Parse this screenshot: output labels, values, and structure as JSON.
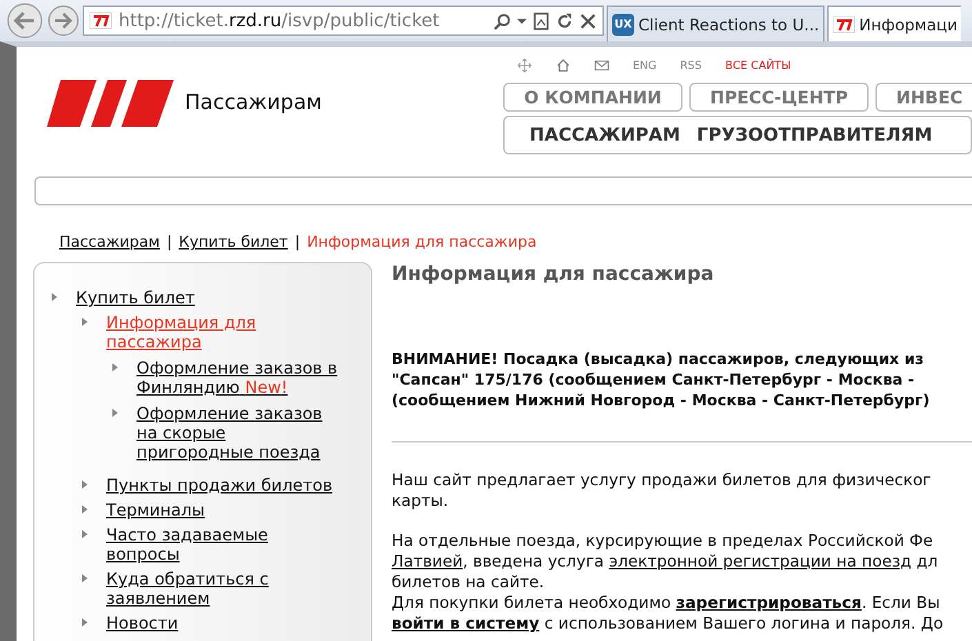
{
  "browser": {
    "address": {
      "prefix": "http://ticket.",
      "domain": "rzd.ru",
      "path": "/isvp/public/ticket"
    },
    "tabs": [
      {
        "favicon_text": "UX",
        "title": "Client Reactions to U...",
        "selected": false
      },
      {
        "title": "Информаци",
        "selected": true
      }
    ]
  },
  "utility_links": [
    {
      "kind": "icon"
    },
    {
      "kind": "icon"
    },
    {
      "kind": "icon"
    },
    {
      "kind": "text",
      "label": "ENG",
      "accent": false
    },
    {
      "kind": "text",
      "label": "RSS",
      "accent": false
    },
    {
      "kind": "text",
      "label": "ВСЕ САЙТЫ",
      "accent": true
    }
  ],
  "logo": {
    "caption": "Пассажирам"
  },
  "top_nav": [
    "О КОМПАНИИ",
    "ПРЕСС-ЦЕНТР",
    "ИНВЕС"
  ],
  "main_nav": [
    "ПАССАЖИРАМ",
    "ГРУЗООТПРАВИТЕЛЯМ"
  ],
  "breadcrumb": [
    {
      "label": "Пассажирам",
      "current": false
    },
    {
      "separator": "|",
      "label": "Купить билет",
      "current": false
    },
    {
      "separator": "|",
      "label": "Информация для пассажира",
      "current": true
    }
  ],
  "sidebar": [
    {
      "label": "Купить билет",
      "selected": false,
      "children": [
        {
          "label": "Информация для пассажира",
          "selected": true,
          "children": [
            {
              "label": "Оформление заказов в Финляндию",
              "badge": "New!",
              "selected": false
            },
            {
              "label": "Оформление заказов на скорые пригородные поезда",
              "selected": false
            }
          ]
        },
        {
          "label": "Пункты продажи билетов",
          "selected": false
        },
        {
          "label": "Терминалы",
          "selected": false
        },
        {
          "label": "Часто задаваемые вопросы",
          "selected": false
        },
        {
          "label": "Куда обратиться с заявлением",
          "selected": false
        },
        {
          "label": "Новости",
          "selected": false
        }
      ]
    }
  ],
  "content": {
    "title": "Информация для пассажира",
    "notice_lines": [
      "ВНИМАНИЕ! Посадка (высадка) пассажиров, следующих из",
      "\"Сапсан\" 175/176 (сообщением Санкт-Петербург - Москва -",
      "(сообщением Нижний Новгород - Москва - Санкт-Петербург)"
    ],
    "paragraphs": [
      [
        [
          {
            "text": "Наш сайт предлагает услугу продажи билетов для физическог",
            "kind": "plain"
          }
        ],
        [
          {
            "text": "карты.",
            "kind": "plain"
          }
        ]
      ],
      [
        [
          {
            "text": "На отдельные поезда, курсирующие в пределах Российской Фе",
            "kind": "plain"
          }
        ],
        [
          {
            "text": "Латвией",
            "kind": "link"
          },
          {
            "text": ", введена услуга ",
            "kind": "plain"
          },
          {
            "text": "электронной регистрации на поезд",
            "kind": "link"
          },
          {
            "text": " дл",
            "kind": "plain"
          }
        ],
        [
          {
            "text": "билетов на сайте.",
            "kind": "plain"
          }
        ],
        [
          {
            "text": "Для покупки билета необходимо ",
            "kind": "plain"
          },
          {
            "text": "зарегистрироваться",
            "kind": "boldlink"
          },
          {
            "text": ". Если Вы",
            "kind": "plain"
          }
        ],
        [
          {
            "text": "войти в систему",
            "kind": "boldlink"
          },
          {
            "text": " с использованием Вашего логина и пароля. До",
            "kind": "plain"
          }
        ]
      ]
    ]
  }
}
